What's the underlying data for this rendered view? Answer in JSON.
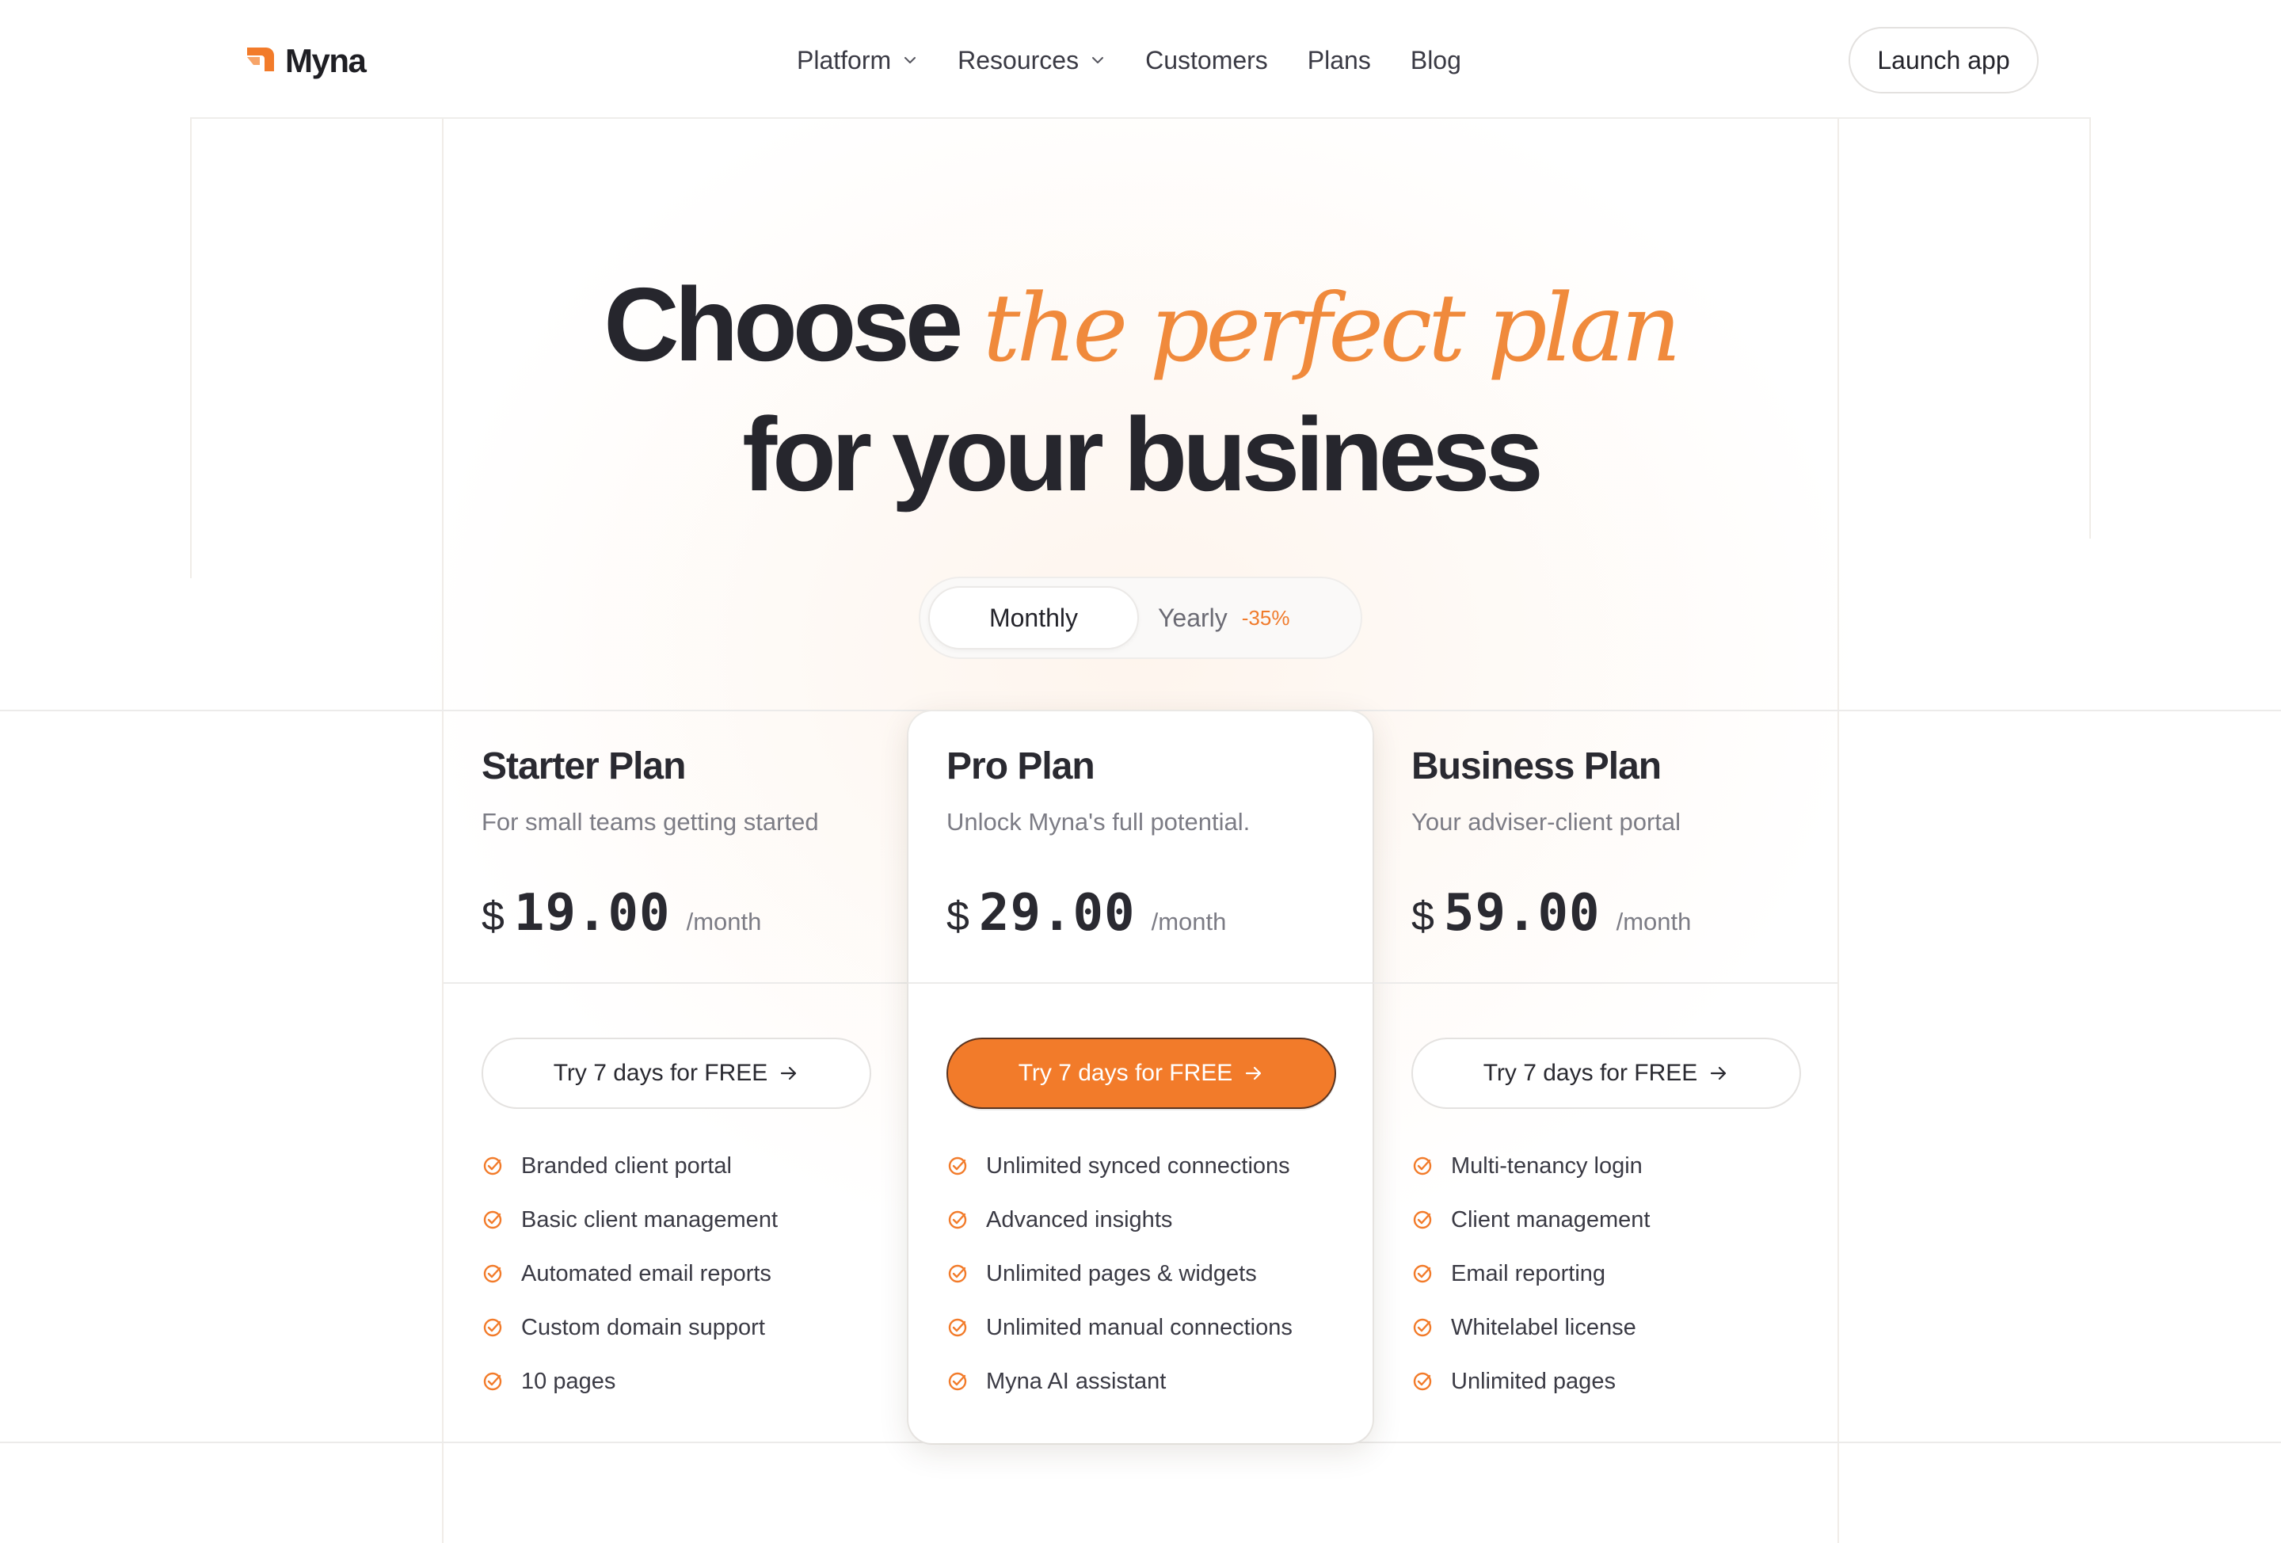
{
  "brand": {
    "name": "Myna",
    "accent": "#f27b2a"
  },
  "nav": {
    "items": [
      {
        "label": "Platform",
        "has_dropdown": true
      },
      {
        "label": "Resources",
        "has_dropdown": true
      },
      {
        "label": "Customers",
        "has_dropdown": false
      },
      {
        "label": "Plans",
        "has_dropdown": false
      },
      {
        "label": "Blog",
        "has_dropdown": false
      }
    ],
    "launch_label": "Launch app"
  },
  "hero": {
    "lead": "Choose",
    "accent": "the perfect plan",
    "line2": "for your business"
  },
  "billing": {
    "monthly": "Monthly",
    "yearly": "Yearly",
    "discount": "-35%",
    "selected": "Monthly"
  },
  "plans": [
    {
      "title": "Starter Plan",
      "subtitle": "For small teams getting started",
      "currency": "$",
      "price": "19.00",
      "period": "/month",
      "cta": "Try 7 days for FREE",
      "features": [
        "Branded client portal",
        "Basic client management",
        "Automated email reports",
        "Custom domain support",
        "10 pages"
      ]
    },
    {
      "title": "Pro Plan",
      "subtitle": "Unlock Myna's full potential.",
      "currency": "$",
      "price": "29.00",
      "period": "/month",
      "cta": "Try 7 days for FREE",
      "highlighted": true,
      "features": [
        "Unlimited synced connections",
        "Advanced insights",
        "Unlimited pages & widgets",
        "Unlimited manual connections",
        "Myna AI assistant"
      ]
    },
    {
      "title": "Business Plan",
      "subtitle": "Your adviser-client portal",
      "currency": "$",
      "price": "59.00",
      "period": "/month",
      "cta": "Try 7 days for FREE",
      "features": [
        "Multi-tenancy login",
        "Client management",
        "Email reporting",
        "Whitelabel license",
        "Unlimited pages"
      ]
    }
  ],
  "icons": {
    "logo": "myna-logo-icon",
    "check": "check-circle-icon",
    "arrow": "arrow-right-icon",
    "chevron": "chevron-down-icon"
  }
}
